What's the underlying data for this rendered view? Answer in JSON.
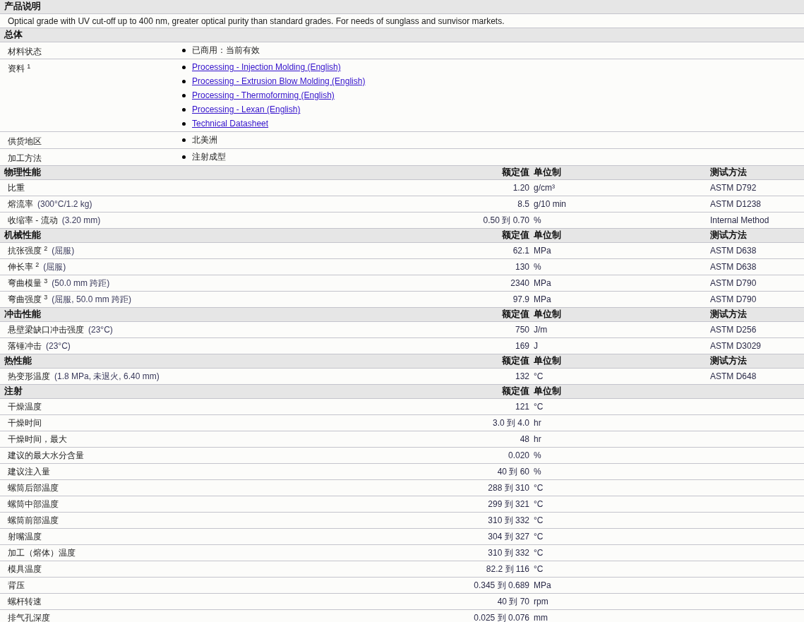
{
  "sections": [
    {
      "kind": "text",
      "title": "产品说明",
      "text": "Optical grade with UV cut-off up to 400 nm, greater optical purity than standard grades. For needs of sunglass and sunvisor markets."
    },
    {
      "kind": "list",
      "title": "总体",
      "rows": [
        {
          "label": "材料状态",
          "items": [
            {
              "text": "已商用：当前有效",
              "link": false
            }
          ]
        },
        {
          "label": "资料 $^{1}$",
          "items": [
            {
              "text": "Processing - Injection Molding (English)",
              "link": true
            },
            {
              "text": "Processing - Extrusion Blow Molding (English)",
              "link": true
            },
            {
              "text": "Processing - Thermoforming (English)",
              "link": true
            },
            {
              "text": "Processing - Lexan (English)",
              "link": true
            },
            {
              "text": "Technical Datasheet",
              "link": true
            }
          ]
        },
        {
          "label": "供货地区",
          "items": [
            {
              "text": "北美洲",
              "link": false
            }
          ]
        },
        {
          "label": "加工方法",
          "items": [
            {
              "text": "注射成型",
              "link": false
            }
          ]
        }
      ]
    },
    {
      "kind": "properties",
      "title": "物理性能",
      "columns": [
        "额定值",
        "单位制",
        "测试方法"
      ],
      "rows": [
        {
          "label": "比重",
          "value": "1.20",
          "unit": "g/cm³",
          "method": "ASTM D792"
        },
        {
          "label": "熔流率",
          "condition": "(300°C/1.2 kg)",
          "value": "8.5",
          "unit": "g/10 min",
          "method": "ASTM D1238"
        },
        {
          "label": "收缩率 - 流动",
          "condition": "(3.20 mm)",
          "value": "0.50 到 0.70",
          "unit": "%",
          "method": "Internal Method"
        }
      ]
    },
    {
      "kind": "properties",
      "title": "机械性能",
      "columns": [
        "额定值",
        "单位制",
        "测试方法"
      ],
      "rows": [
        {
          "label": "抗张强度 $^{2}$",
          "condition": "(屈服)",
          "value": "62.1",
          "unit": "MPa",
          "method": "ASTM D638"
        },
        {
          "label": "伸长率 $^{2}$",
          "condition": "(屈服)",
          "value": "130",
          "unit": "%",
          "method": "ASTM D638"
        },
        {
          "label": "弯曲模量 $^{3}$",
          "condition": "(50.0 mm 跨距)",
          "value": "2340",
          "unit": "MPa",
          "method": "ASTM D790"
        },
        {
          "label": "弯曲强度 $^{3}$",
          "condition": "(屈服, 50.0 mm 跨距)",
          "value": "97.9",
          "unit": "MPa",
          "method": "ASTM D790"
        }
      ]
    },
    {
      "kind": "properties",
      "title": "冲击性能",
      "columns": [
        "额定值",
        "单位制",
        "测试方法"
      ],
      "rows": [
        {
          "label": "悬壁梁缺口冲击强度",
          "condition": "(23°C)",
          "value": "750",
          "unit": "J/m",
          "method": "ASTM D256"
        },
        {
          "label": "落锤冲击",
          "condition": "(23°C)",
          "value": "169",
          "unit": "J",
          "method": "ASTM D3029"
        }
      ]
    },
    {
      "kind": "properties",
      "title": "热性能",
      "columns": [
        "额定值",
        "单位制",
        "测试方法"
      ],
      "rows": [
        {
          "label": "热变形温度",
          "condition": "(1.8 MPa, 未退火, 6.40 mm)",
          "value": "132",
          "unit": "°C",
          "method": "ASTM D648"
        }
      ]
    },
    {
      "kind": "properties",
      "title": "注射",
      "columns": [
        "额定值",
        "单位制"
      ],
      "rows": [
        {
          "label": "干燥温度",
          "value": "121",
          "unit": "°C"
        },
        {
          "label": "干燥时间",
          "value": "3.0 到 4.0",
          "unit": "hr"
        },
        {
          "label": "干燥时间，最大",
          "value": "48",
          "unit": "hr"
        },
        {
          "label": "建议的最大水分含量",
          "value": "0.020",
          "unit": "%"
        },
        {
          "label": "建议注入量",
          "value": "40 到 60",
          "unit": "%"
        },
        {
          "label": "螺筒后部温度",
          "value": "288 到 310",
          "unit": "°C"
        },
        {
          "label": "螺筒中部温度",
          "value": "299 到 321",
          "unit": "°C"
        },
        {
          "label": "螺筒前部温度",
          "value": "310 到 332",
          "unit": "°C"
        },
        {
          "label": "射嘴温度",
          "value": "304 到 327",
          "unit": "°C"
        },
        {
          "label": "加工（熔体）温度",
          "value": "310 到 332",
          "unit": "°C"
        },
        {
          "label": "模具温度",
          "value": "82.2 到 116",
          "unit": "°C"
        },
        {
          "label": "背压",
          "value": "0.345 到 0.689",
          "unit": "MPa"
        },
        {
          "label": "螺杆转速",
          "value": "40 到 70",
          "unit": "rpm"
        },
        {
          "label": "排气孔深度",
          "value": "0.025 到 0.076",
          "unit": "mm"
        }
      ]
    }
  ]
}
